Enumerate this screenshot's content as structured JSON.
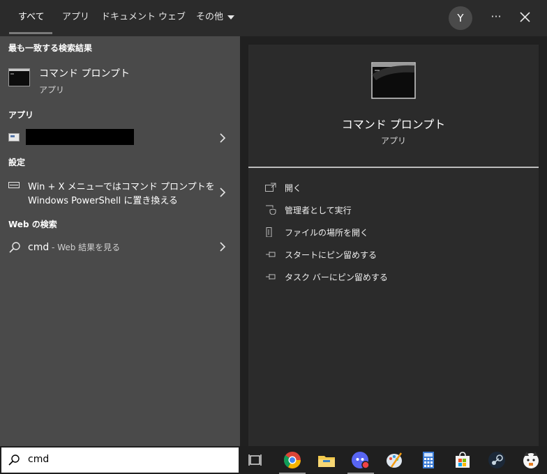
{
  "tabs": [
    {
      "label": "すべて",
      "active": true
    },
    {
      "label": "アプリ"
    },
    {
      "label": "ドキュメント"
    },
    {
      "label": "ウェブ"
    },
    {
      "label": "その他"
    }
  ],
  "user_initial": "Y",
  "more_label": "···",
  "left": {
    "best_match_header": "最も一致する検索結果",
    "best_match": {
      "name": "コマンド プロンプト",
      "type": "アプリ"
    },
    "apps_header": "アプリ",
    "settings_header": "設定",
    "setting_line1": "Win + X メニューではコマンド プロンプトを",
    "setting_line2": "Windows PowerShell に置き換える",
    "web_header": "Web の検索",
    "web_query": "cmd",
    "web_suffix": " - Web 結果を見る"
  },
  "detail": {
    "name": "コマンド プロンプト",
    "type": "アプリ",
    "actions": [
      {
        "label": "開く",
        "icon": "open-icon"
      },
      {
        "label": "管理者として実行",
        "icon": "shield-icon"
      },
      {
        "label": "ファイルの場所を開く",
        "icon": "file-location-icon"
      },
      {
        "label": "スタートにピン留めする",
        "icon": "pin-icon"
      },
      {
        "label": "タスク バーにピン留めする",
        "icon": "pin-icon"
      }
    ]
  },
  "search": {
    "value": "cmd"
  },
  "taskbar_icons": [
    "task-view-icon",
    "chrome-icon",
    "file-explorer-icon",
    "discord-icon",
    "paint-icon",
    "calculator-icon",
    "store-icon",
    "steam-icon",
    "app-character-icon"
  ]
}
